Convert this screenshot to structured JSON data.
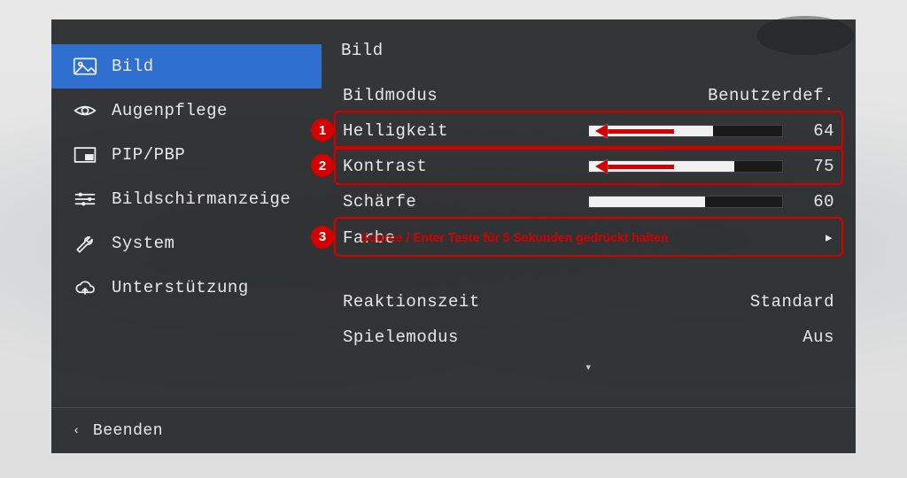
{
  "sidebar": {
    "items": [
      {
        "id": "picture",
        "label": "Bild",
        "icon": "picture",
        "selected": true
      },
      {
        "id": "eyecare",
        "label": "Augenpflege",
        "icon": "eye",
        "selected": false
      },
      {
        "id": "pip",
        "label": "PIP/PBP",
        "icon": "pip",
        "selected": false
      },
      {
        "id": "osd",
        "label": "Bildschirmanzeige",
        "icon": "sliders",
        "selected": false
      },
      {
        "id": "system",
        "label": "System",
        "icon": "wrench",
        "selected": false
      },
      {
        "id": "support",
        "label": "Unterstützung",
        "icon": "cloud",
        "selected": false
      }
    ]
  },
  "panel": {
    "title": "Bild",
    "settings": [
      {
        "id": "mode",
        "label": "Bildmodus",
        "type": "enum",
        "value": "Benutzerdef."
      },
      {
        "id": "brightness",
        "label": "Helligkeit",
        "type": "slider",
        "value": 64,
        "max": 100
      },
      {
        "id": "contrast",
        "label": "Kontrast",
        "type": "slider",
        "value": 75,
        "max": 100
      },
      {
        "id": "sharpness",
        "label": "Schärfe",
        "type": "slider",
        "value": 60,
        "max": 100
      },
      {
        "id": "color",
        "label": "Farbe",
        "type": "submenu"
      },
      {
        "id": "response",
        "label": "Reaktionszeit",
        "type": "enum",
        "value": "Standard"
      },
      {
        "id": "gamemode",
        "label": "Spielemodus",
        "type": "enum",
        "value": "Aus"
      }
    ],
    "scroll_indicator": "▾"
  },
  "footer": {
    "back_caret": "‹",
    "back_label": "Beenden"
  },
  "annotations": [
    {
      "n": 1,
      "target": "brightness"
    },
    {
      "n": 2,
      "target": "contrast"
    },
    {
      "n": 3,
      "target": "color",
      "text": "Source / Enter Taste für 5 Sekunden gedrückt halten"
    }
  ],
  "colors": {
    "selection": "#2f6fd0",
    "annotation": "#d40000"
  }
}
